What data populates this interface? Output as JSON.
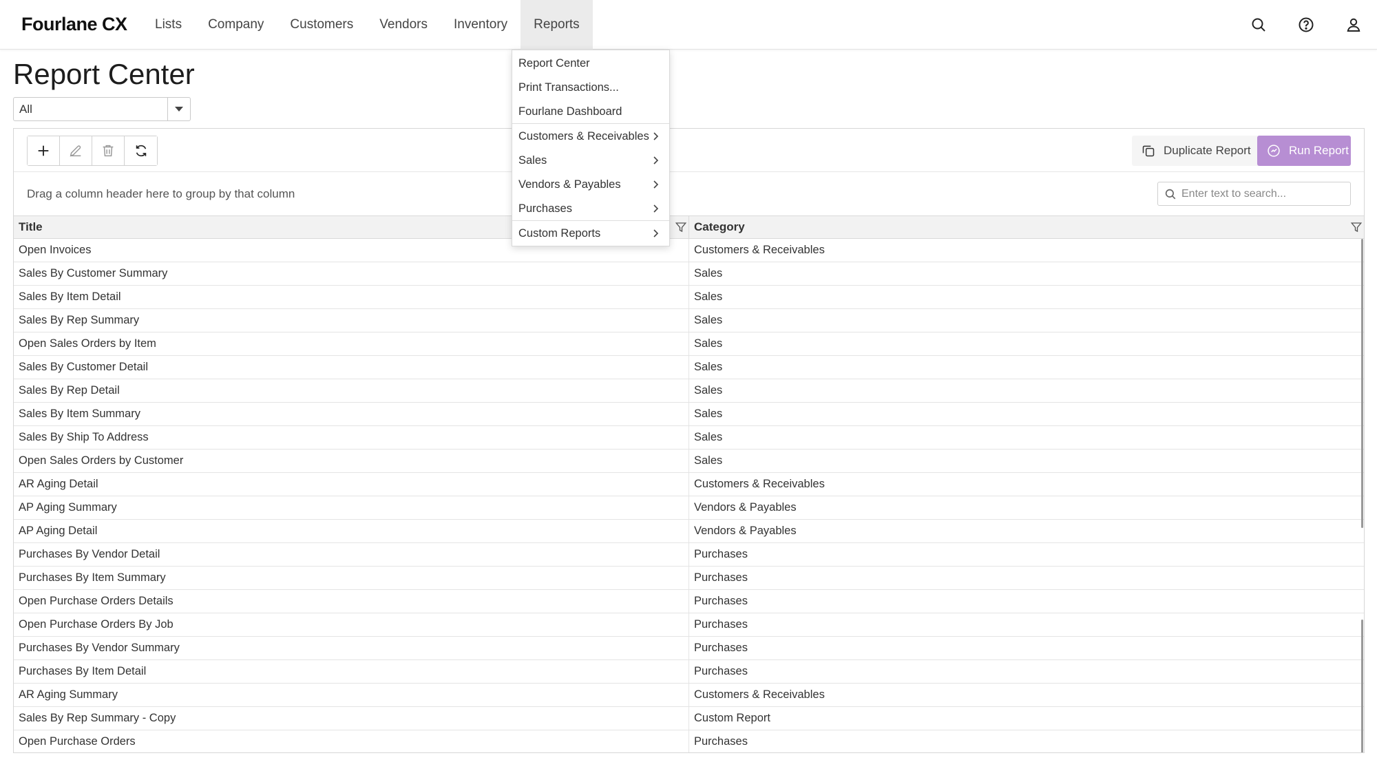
{
  "app": {
    "brand": "Fourlane CX"
  },
  "nav": {
    "items": [
      {
        "label": "Lists"
      },
      {
        "label": "Company"
      },
      {
        "label": "Customers"
      },
      {
        "label": "Vendors"
      },
      {
        "label": "Inventory"
      },
      {
        "label": "Reports"
      }
    ],
    "active": "Reports",
    "icons": [
      "search-icon",
      "help-icon",
      "user-icon"
    ]
  },
  "page": {
    "title": "Report Center",
    "filter": {
      "value": "All"
    }
  },
  "toolbar": {
    "icons": [
      "plus-icon",
      "pencil-icon",
      "trash-icon",
      "refresh-icon"
    ],
    "duplicate_label": "Duplicate Report",
    "run_label": "Run Report",
    "run_color": "#b78ed3"
  },
  "grid": {
    "group_hint": "Drag a column header here to group by that column",
    "search_placeholder": "Enter text to search...",
    "columns": [
      "Title",
      "Category"
    ],
    "rows": [
      [
        "Open Invoices",
        "Customers & Receivables"
      ],
      [
        "Sales By Customer Summary",
        "Sales"
      ],
      [
        "Sales By Item Detail",
        "Sales"
      ],
      [
        "Sales By Rep Summary",
        "Sales"
      ],
      [
        "Open Sales Orders by Item",
        "Sales"
      ],
      [
        "Sales By Customer Detail",
        "Sales"
      ],
      [
        "Sales By Rep Detail",
        "Sales"
      ],
      [
        "Sales By Item Summary",
        "Sales"
      ],
      [
        "Sales By Ship To Address",
        "Sales"
      ],
      [
        "Open Sales Orders by Customer",
        "Sales"
      ],
      [
        "AR Aging Detail",
        "Customers & Receivables"
      ],
      [
        "AP Aging Summary",
        "Vendors & Payables"
      ],
      [
        "AP Aging Detail",
        "Vendors & Payables"
      ],
      [
        "Purchases By Vendor Detail",
        "Purchases"
      ],
      [
        "Purchases By Item Summary",
        "Purchases"
      ],
      [
        "Open Purchase Orders Details",
        "Purchases"
      ],
      [
        "Open Purchase Orders By Job",
        "Purchases"
      ],
      [
        "Purchases By Vendor Summary",
        "Purchases"
      ],
      [
        "Purchases By Item Detail",
        "Purchases"
      ],
      [
        "AR Aging Summary",
        "Customers & Receivables"
      ],
      [
        "Sales By Rep Summary - Copy",
        "Custom Report"
      ],
      [
        "Open Purchase Orders",
        "Purchases"
      ]
    ]
  },
  "reports_menu": {
    "items": [
      {
        "label": "Report Center",
        "submenu": false
      },
      {
        "label": "Print Transactions...",
        "submenu": false
      },
      {
        "label": "Fourlane Dashboard",
        "submenu": false
      },
      {
        "label": "Customers & Receivables",
        "submenu": true
      },
      {
        "label": "Sales",
        "submenu": true
      },
      {
        "label": "Vendors & Payables",
        "submenu": true
      },
      {
        "label": "Purchases",
        "submenu": true
      },
      {
        "label": "Custom Reports",
        "submenu": true
      }
    ]
  }
}
